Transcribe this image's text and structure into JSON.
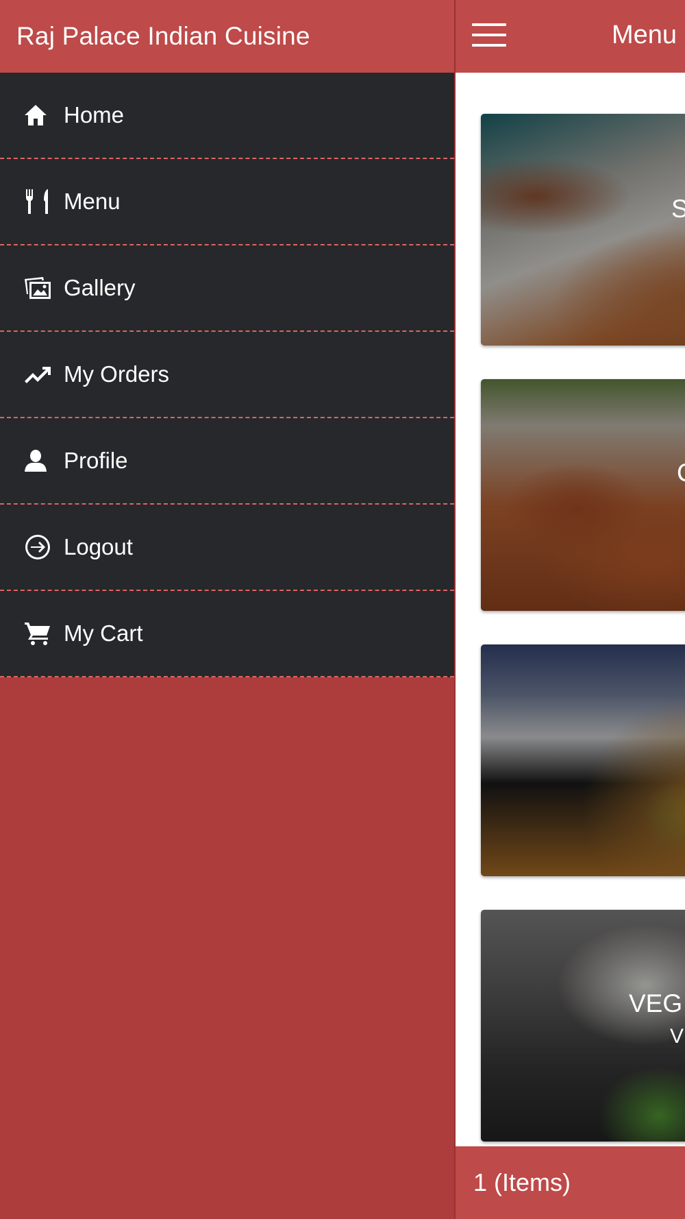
{
  "drawer": {
    "title": "Raj Palace Indian Cuisine",
    "items": [
      {
        "label": "Home",
        "icon": "home-icon"
      },
      {
        "label": "Menu",
        "icon": "fork-knife-icon"
      },
      {
        "label": "Gallery",
        "icon": "gallery-icon"
      },
      {
        "label": "My Orders",
        "icon": "trending-up-icon"
      },
      {
        "label": "Profile",
        "icon": "person-icon"
      },
      {
        "label": "Logout",
        "icon": "logout-icon"
      },
      {
        "label": "My Cart",
        "icon": "cart-icon"
      }
    ]
  },
  "main": {
    "title": "Menu",
    "cards": [
      {
        "title": "S",
        "subtitle": ""
      },
      {
        "title": "C",
        "subtitle": ""
      },
      {
        "title": "",
        "subtitle": ""
      },
      {
        "title": "VEG",
        "subtitle": "V"
      }
    ]
  },
  "footer": {
    "cart_count": "1 (Items)"
  },
  "colors": {
    "header": "#be4a49",
    "drawer_bg": "#26282b",
    "page_bg": "#ad3d3d",
    "divider": "#e06464"
  }
}
